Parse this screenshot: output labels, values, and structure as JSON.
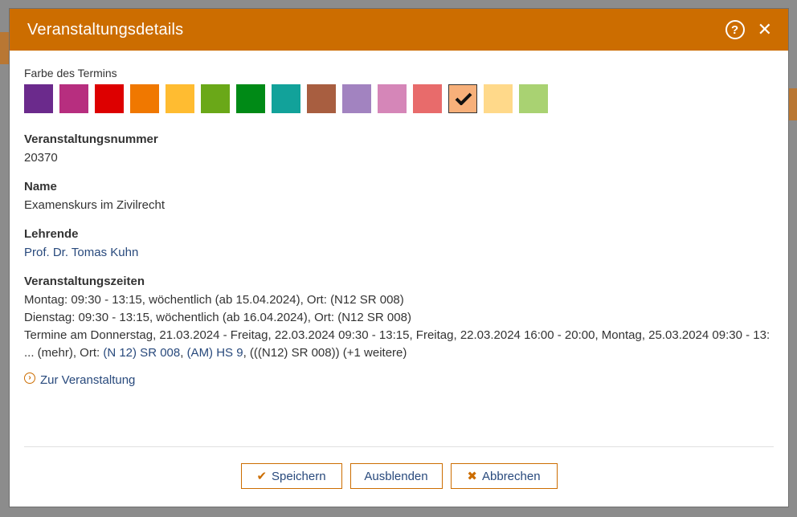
{
  "dialog": {
    "title": "Veranstaltungsdetails",
    "help_icon": "help-circle-icon",
    "close_icon": "close-icon"
  },
  "color_picker": {
    "label": "Farbe des Termins",
    "swatches": [
      {
        "color": "#6b2a8c",
        "selected": false
      },
      {
        "color": "#b72e7f",
        "selected": false
      },
      {
        "color": "#dd0000",
        "selected": false
      },
      {
        "color": "#f07800",
        "selected": false
      },
      {
        "color": "#ffbc31",
        "selected": false
      },
      {
        "color": "#6aa818",
        "selected": false
      },
      {
        "color": "#008a16",
        "selected": false
      },
      {
        "color": "#12a29a",
        "selected": false
      },
      {
        "color": "#a85e40",
        "selected": false
      },
      {
        "color": "#a283c0",
        "selected": false
      },
      {
        "color": "#d586b8",
        "selected": false
      },
      {
        "color": "#e86b6b",
        "selected": false
      },
      {
        "color": "#f7b07a",
        "selected": true
      },
      {
        "color": "#ffd98a",
        "selected": false
      },
      {
        "color": "#a9d272",
        "selected": false
      }
    ]
  },
  "fields": {
    "number_label": "Veranstaltungsnummer",
    "number_value": "20370",
    "name_label": "Name",
    "name_value": "Examenskurs im Zivilrecht",
    "lecturers_label": "Lehrende",
    "lecturer_value": "Prof. Dr. Tomas Kuhn",
    "times_label": "Veranstaltungszeiten",
    "times_line1": "Montag: 09:30 - 13:15, wöchentlich (ab 15.04.2024), Ort: (N12 SR 008)",
    "times_line2": "Dienstag: 09:30 - 13:15, wöchentlich (ab 16.04.2024), Ort: (N12 SR 008)",
    "times_line3_prefix": "Termine am Donnerstag, 21.03.2024 - Freitag, 22.03.2024 09:30 - 13:15, Freitag, 22.03.2024 16:00 - 20:00, Montag, 25.03.2024 09:30 - 13: ... (mehr), Ort: ",
    "times_line3_link1": "(N 12) SR 008",
    "times_line3_sep": ", ",
    "times_line3_link2": "(AM) HS 9",
    "times_line3_suffix": ", (((N12) SR 008)) (+1 weitere)"
  },
  "go_link": {
    "label": "Zur Veranstaltung",
    "icon": "chevron-right-circle-icon"
  },
  "buttons": {
    "save_label": "Speichern",
    "hide_label": "Ausblenden",
    "cancel_label": "Abbrechen"
  }
}
